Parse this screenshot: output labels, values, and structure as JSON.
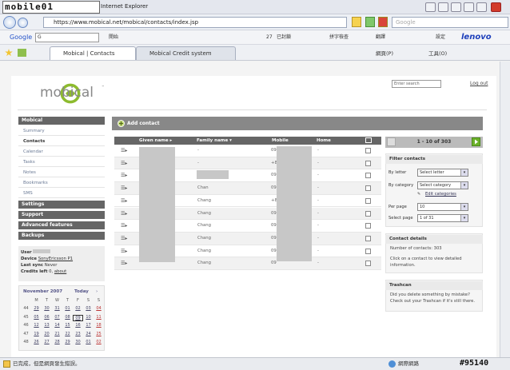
{
  "browser": {
    "site_logo_text": "mobile01",
    "window_title": "Internet Explorer",
    "url": "https://www.mobical.net/mobical/contacts/index.jsp",
    "search_placeholder": "Google",
    "google_toolbar": {
      "label": "Google",
      "input_value": "G",
      "items": [
        "開始",
        "27",
        "已封鎖",
        "拼字檢查",
        "翻譯",
        "設定"
      ],
      "brand": "lenovo"
    },
    "tabs": [
      {
        "label": "Mobical | Contacts",
        "active": true
      },
      {
        "label": "Mobical Credit system",
        "active": false
      }
    ],
    "toolbar_right": [
      "網頁(P)",
      "工具(O)"
    ],
    "status_text": "已完成，但是網頁發生錯誤。",
    "status_zone": "網際網路",
    "watermark": "#95140"
  },
  "app": {
    "logo": "mobical",
    "logo_tm": "™",
    "search_placeholder": "Enter search",
    "logout": "Log out",
    "brand_green": "#8dbb2e"
  },
  "sidebar": {
    "sections": [
      {
        "label": "Mobical",
        "items": [
          "Summary",
          "Contacts",
          "Calendar",
          "Tasks",
          "Notes",
          "Bookmarks",
          "SMS"
        ],
        "selected": "Contacts"
      },
      {
        "label": "Settings"
      },
      {
        "label": "Support"
      },
      {
        "label": "Advanced features"
      },
      {
        "label": "Backups"
      }
    ],
    "user": {
      "user_label": "User",
      "device_label": "Device",
      "device_value": "SonyEricsson P1",
      "last_sync_label": "Last sync",
      "last_sync_value": "Never",
      "credits_label": "Credits left",
      "credits_value": "0,",
      "credits_link": "about"
    }
  },
  "calendar": {
    "month": "November 2007",
    "today_label": "Today",
    "weekdays": [
      "M",
      "T",
      "W",
      "T",
      "F",
      "S",
      "S"
    ],
    "weeks": [
      [
        "44",
        "29",
        "30",
        "31",
        "01",
        "02",
        "03",
        "04"
      ],
      [
        "45",
        "05",
        "06",
        "07",
        "08",
        "09",
        "10",
        "11"
      ],
      [
        "46",
        "12",
        "13",
        "14",
        "15",
        "16",
        "17",
        "18"
      ],
      [
        "47",
        "19",
        "20",
        "21",
        "22",
        "23",
        "24",
        "25"
      ],
      [
        "48",
        "26",
        "27",
        "28",
        "29",
        "30",
        "01",
        "02"
      ]
    ],
    "today": "09"
  },
  "contacts": {
    "add_label": "Add contact",
    "columns": {
      "given": "Given name ▸",
      "family": "Family name ▾",
      "mobile": "Mobile",
      "home": "Home"
    },
    "rows": [
      {
        "family": "-",
        "mobile": "09",
        "home": "-"
      },
      {
        "family": "-",
        "mobile": "+8",
        "home": "-"
      },
      {
        "family": "",
        "mobile": "09",
        "home": "-"
      },
      {
        "family": "Chan",
        "mobile": "09",
        "home": "-"
      },
      {
        "family": "Chang",
        "mobile": "+8",
        "home": "-"
      },
      {
        "family": "Chang",
        "mobile": "09",
        "home": "-"
      },
      {
        "family": "Chang",
        "mobile": "09",
        "home": "-"
      },
      {
        "family": "Chang",
        "mobile": "09",
        "home": "-"
      },
      {
        "family": "Chang",
        "mobile": "09",
        "home": "-"
      },
      {
        "family": "Chang",
        "mobile": "09",
        "home": "-"
      }
    ]
  },
  "pager": {
    "text": "1 - 10 of 303"
  },
  "filter": {
    "title": "Filter contacts",
    "by_letter_label": "By letter",
    "by_letter_value": "Select letter",
    "by_category_label": "By category",
    "by_category_value": "Select category",
    "edit_categories": "Edit categories",
    "per_page_label": "Per page",
    "per_page_value": "10",
    "select_page_label": "Select page",
    "select_page_value": "1 of 31"
  },
  "contact_details": {
    "title": "Contact details",
    "count_text": "Number of contacts: 303",
    "hint": "Click on a contact to view detailed information."
  },
  "trashcan": {
    "title": "Trashcan",
    "text": "Did you delete something by mistake? Check out your Trashcan if it's still there."
  }
}
